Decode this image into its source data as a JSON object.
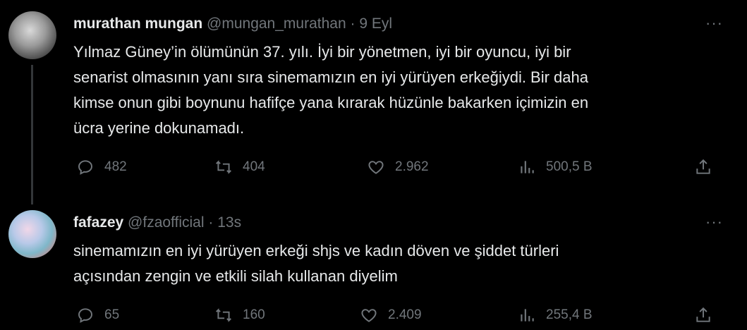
{
  "tweets": [
    {
      "name": "murathan mungan",
      "handle": "@mungan_murathan",
      "dot": "·",
      "time": "9 Eyl",
      "more": "···",
      "text": "Yılmaz Güney’in ölümünün 37.  yılı. İyi bir yönetmen, iyi bir oyuncu, iyi bir senarist olmasının yanı sıra sinemamızın en iyi yürüyen erkeğiydi. Bir daha kimse onun gibi boynunu hafifçe yana kırarak hüzünle bakarken içimizin en ücra yerine dokunamadı.",
      "lines": [
        "Yılmaz Güney’in ölümünün 37.  yılı. İyi bir yönetmen, iyi bir oyuncu, iyi bir",
        "senarist olmasının yanı sıra sinemamızın en iyi yürüyen erkeğiydi. Bir daha",
        "kimse onun gibi boynunu hafifçe yana kırarak hüzünle bakarken içimizin en",
        "ücra yerine dokunamadı."
      ],
      "replies": "482",
      "retweets": "404",
      "likes": "2.962",
      "views": "500,5 B"
    },
    {
      "name": "fafazey",
      "handle": "@fzaofficial",
      "dot": "·",
      "time": "13s",
      "more": "···",
      "lines": [
        "sinemamızın en iyi yürüyen erkeği shjs ve kadın döven ve şiddet türleri",
        "açısından zengin ve etkili silah kullanan diyelim"
      ],
      "replies": "65",
      "retweets": "160",
      "likes": "2.409",
      "views": "255,4 B"
    }
  ],
  "icons": {
    "reply": "reply-icon",
    "retweet": "retweet-icon",
    "like": "heart-icon",
    "views": "views-icon",
    "share": "share-icon",
    "more": "more-icon"
  },
  "colors": {
    "background": "#000000",
    "text": "#e7e9ea",
    "muted": "#71767b",
    "thread_line": "#333639"
  }
}
